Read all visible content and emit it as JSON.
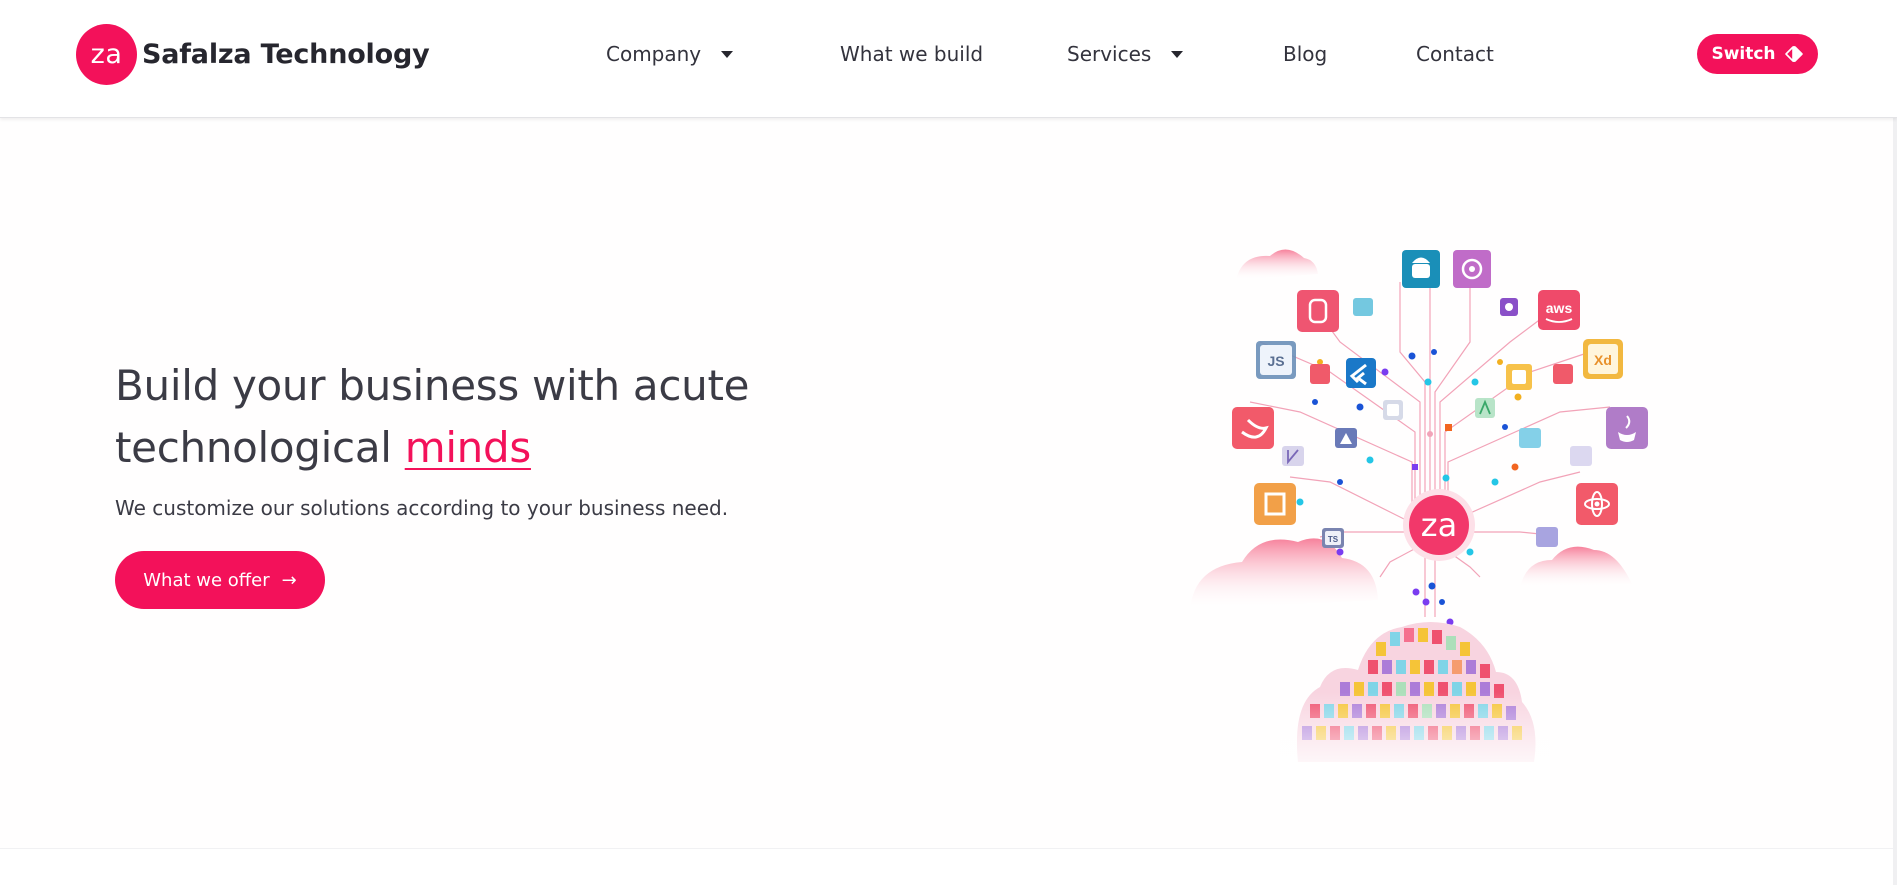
{
  "brand": {
    "logo_mark": "za",
    "name": "Safalza Technology",
    "accent_color": "#f3115a"
  },
  "nav": {
    "items": [
      {
        "label": "Company",
        "has_dropdown": true
      },
      {
        "label": "What we build",
        "has_dropdown": false
      },
      {
        "label": "Services",
        "has_dropdown": true
      },
      {
        "label": "Blog",
        "has_dropdown": false
      },
      {
        "label": "Contact",
        "has_dropdown": false
      }
    ],
    "switch_label": "Switch",
    "switch_icon": "theme-toggle-icon",
    "dropdown_icon": "caret-down-icon"
  },
  "hero": {
    "title_line1": "Build your business with acute",
    "title_line2": "technological",
    "title_highlight": "minds",
    "subtitle": "We customize our solutions according to your business need.",
    "cta_label": "What we offer",
    "cta_icon": "arrow-right-icon",
    "illustration": {
      "center_mark": "za",
      "badges": {
        "js": "JS",
        "aws": "aws",
        "xd": "Xd",
        "ts": "TS"
      },
      "icons": [
        "android-icon",
        "settings-sun-icon",
        "figma-icon",
        "aws-icon",
        "javascript-icon",
        "flutter-icon",
        "adobe-xd-icon",
        "swift-icon",
        "java-icon",
        "python-icon",
        "react-icon",
        "typescript-icon",
        "vue-icon",
        "kotlin-icon",
        "cloud-icon",
        "server-icon"
      ]
    }
  }
}
